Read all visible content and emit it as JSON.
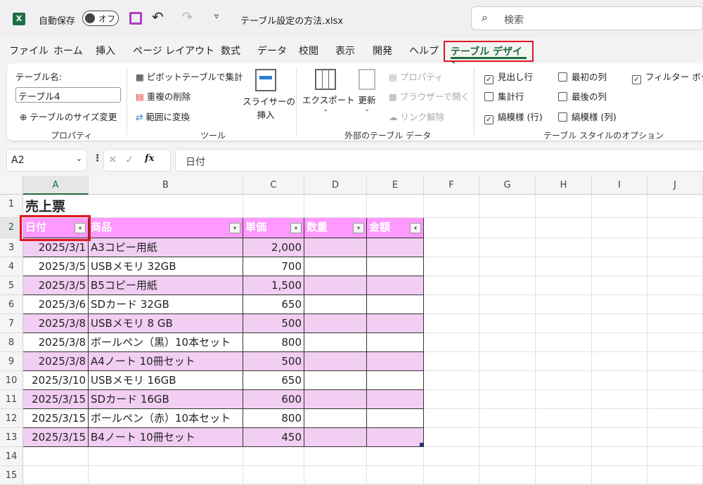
{
  "titlebar": {
    "autosave_label": "自動保存",
    "autosave_state": "オフ",
    "filename": "テーブル設定の方法.xlsx",
    "search_placeholder": "検索"
  },
  "menu": [
    "ファイル",
    "ホーム",
    "挿入",
    "ページ レイアウト",
    "数式",
    "データ",
    "校閲",
    "表示",
    "開発",
    "ヘルプ",
    "テーブル デザイン"
  ],
  "ribbon": {
    "properties": {
      "table_name_label": "テーブル名:",
      "table_name": "テーブル4",
      "resize": "テーブルのサイズ変更",
      "group": "プロパティ"
    },
    "tools": {
      "pivot": "ピボットテーブルで集計",
      "dedupe": "重複の削除",
      "convert": "範囲に変換",
      "slicer1": "スライサーの",
      "slicer2": "挿入",
      "group": "ツール"
    },
    "external": {
      "export": "エクスポート",
      "refresh": "更新",
      "props": "プロパティ",
      "browser": "ブラウザーで開く",
      "unlink": "リンク解除",
      "group": "外部のテーブル データ"
    },
    "style_options": {
      "header_row": "見出し行",
      "total_row": "集計行",
      "banded_rows": "縞模様 (行)",
      "first_col": "最初の列",
      "last_col": "最後の列",
      "banded_cols": "縞模様 (列)",
      "filter_button": "フィルター ボタン",
      "group": "テーブル スタイルのオプション",
      "checked": {
        "header_row": true,
        "total_row": false,
        "banded_rows": true,
        "first_col": false,
        "last_col": false,
        "banded_cols": false,
        "filter_button": true
      }
    }
  },
  "formula_bar": {
    "name_box": "A2",
    "fx": "fx",
    "value": "日付"
  },
  "columns": [
    "A",
    "B",
    "C",
    "D",
    "E",
    "F",
    "G",
    "H",
    "I",
    "J"
  ],
  "rows": [
    "1",
    "2",
    "3",
    "4",
    "5",
    "6",
    "7",
    "8",
    "9",
    "10",
    "11",
    "12",
    "13",
    "14",
    "15"
  ],
  "sheet": {
    "title": "売上票",
    "headers": [
      "日付",
      "商品",
      "単価",
      "数量",
      "金額"
    ],
    "data": [
      [
        "2025/3/1",
        "A3コピー用紙",
        "2,000"
      ],
      [
        "2025/3/5",
        "USBメモリ 32GB",
        "700"
      ],
      [
        "2025/3/5",
        "B5コピー用紙",
        "1,500"
      ],
      [
        "2025/3/6",
        "SDカード 32GB",
        "650"
      ],
      [
        "2025/3/8",
        "USBメモリ  8 GB",
        "500"
      ],
      [
        "2025/3/8",
        "ボールペン（黒）10本セット",
        "800"
      ],
      [
        "2025/3/8",
        "A4ノート 10冊セット",
        "500"
      ],
      [
        "2025/3/10",
        "USBメモリ 16GB",
        "650"
      ],
      [
        "2025/3/15",
        "SDカード 16GB",
        "600"
      ],
      [
        "2025/3/15",
        "ボールペン（赤）10本セット",
        "800"
      ],
      [
        "2025/3/15",
        "B4ノート 10冊セット",
        "450"
      ]
    ]
  },
  "colors": {
    "header": "#ff99ff",
    "band": "#f2cef2",
    "accent": "#1d6b3a",
    "highlight": "#e0161e"
  }
}
